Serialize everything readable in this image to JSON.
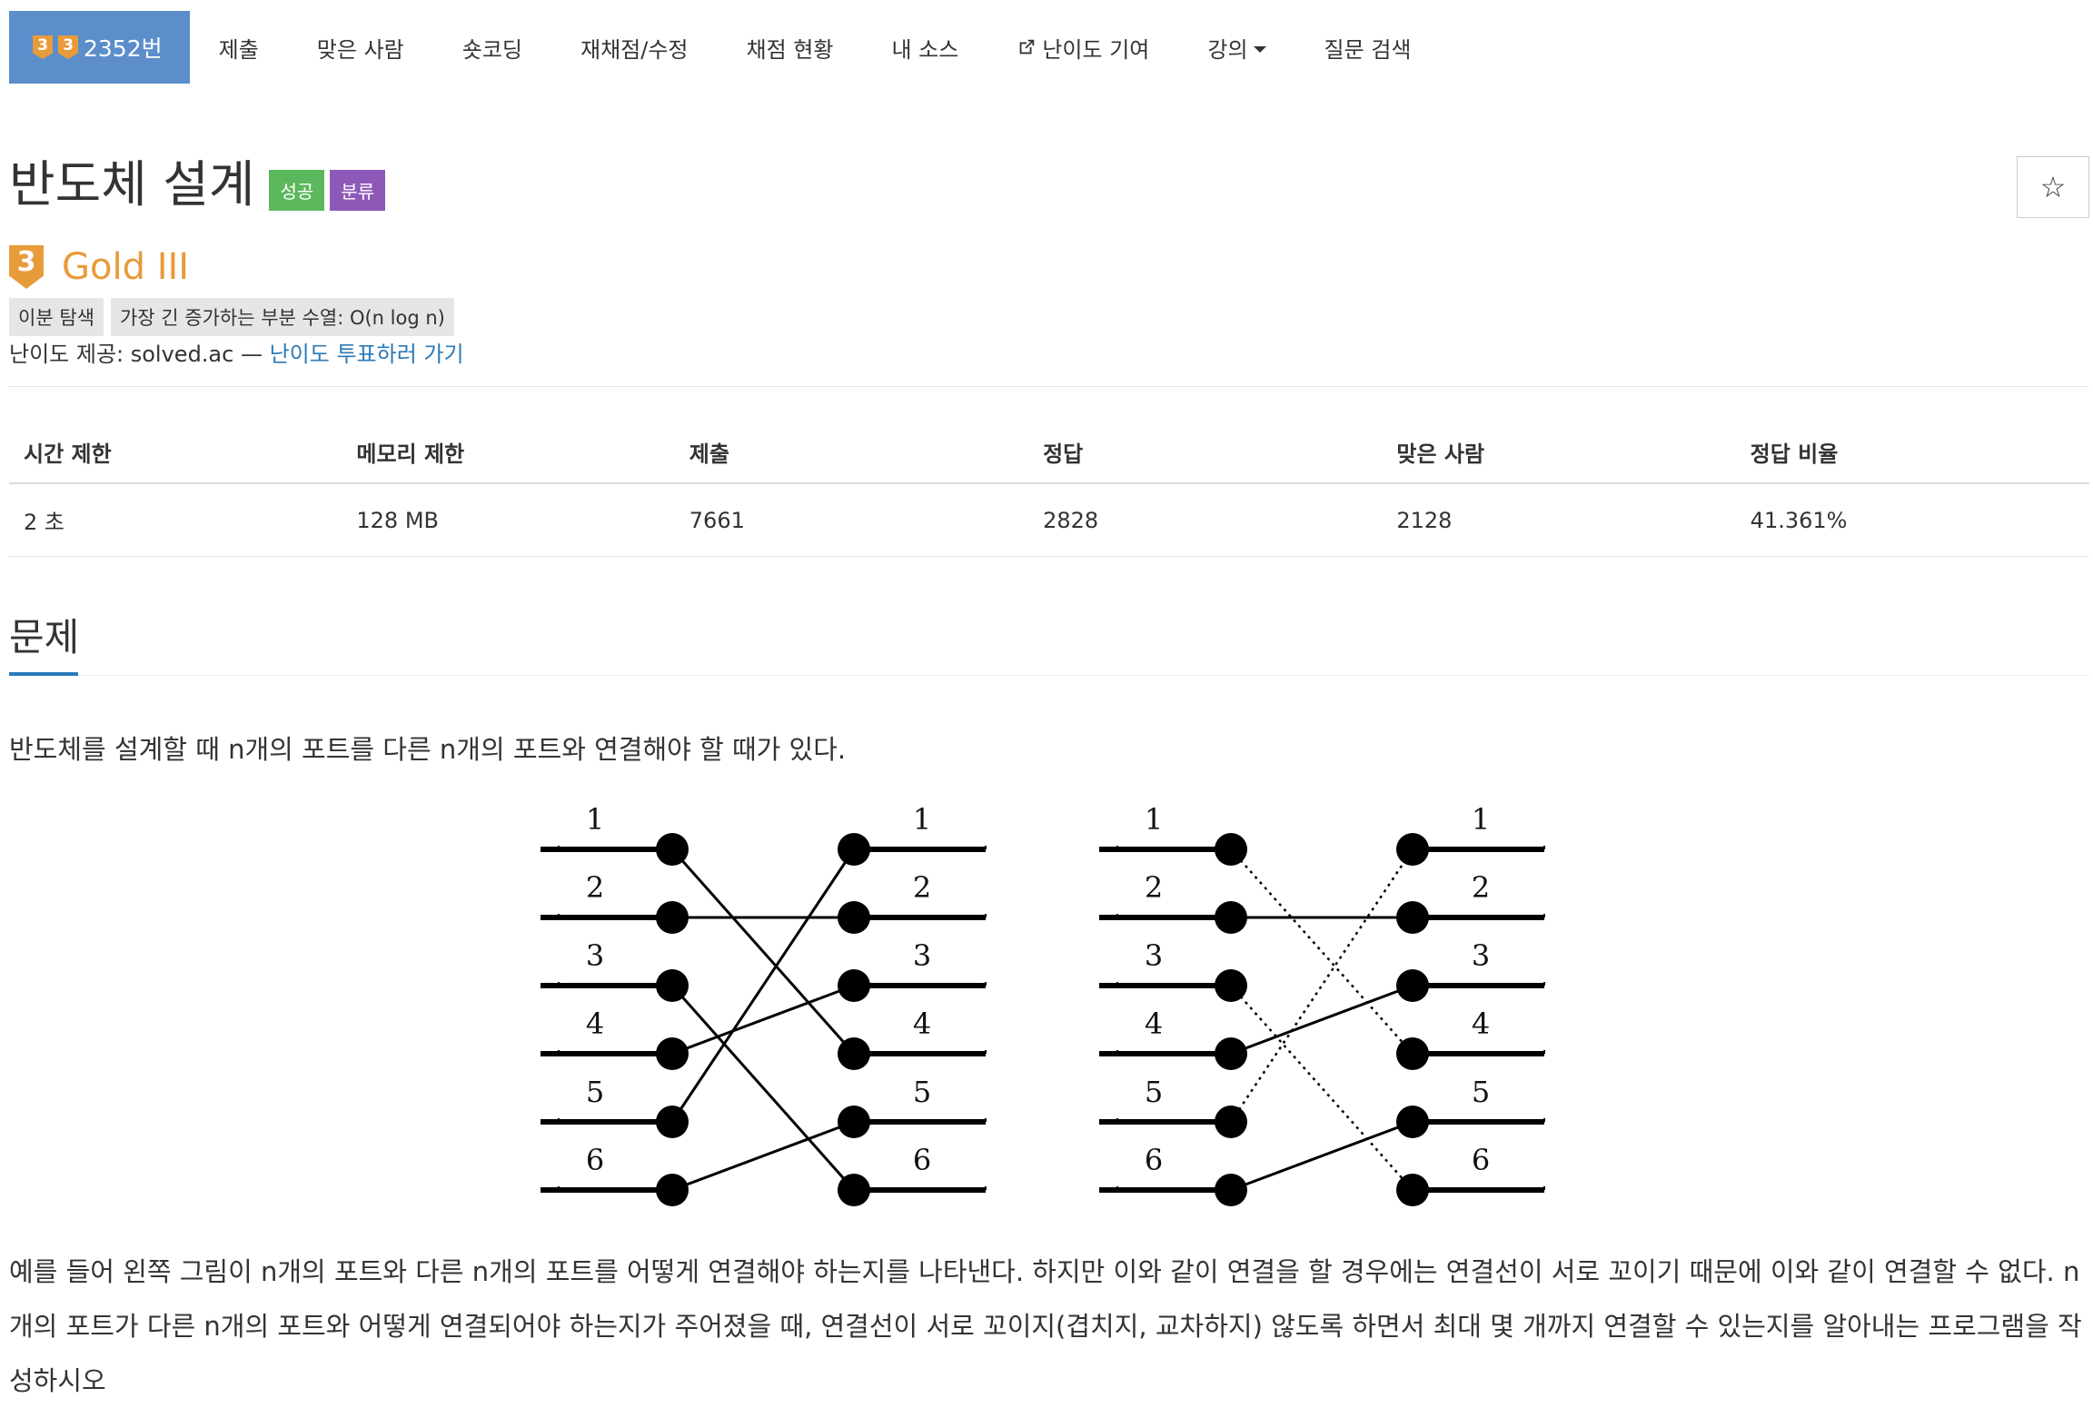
{
  "nav": {
    "problem_tiers": [
      "3",
      "3"
    ],
    "problem_number": "2352번",
    "items": [
      "제출",
      "맞은 사람",
      "숏코딩",
      "재채점/수정",
      "채점 현황",
      "내 소스"
    ],
    "contribute": "난이도 기여",
    "lecture": "강의",
    "qna": "질문 검색"
  },
  "problem": {
    "title": "반도체 설계",
    "badge_success": "성공",
    "badge_category": "분류",
    "star": "☆",
    "tier_number": "3",
    "tier_name": "Gold III",
    "tags": [
      "이분 탐색",
      "가장 긴 증가하는 부분 수열: O(n log n)"
    ],
    "provider_prefix": "난이도 제공: solved.ac — ",
    "vote_link": "난이도 투표하러 가기"
  },
  "table": {
    "headers": [
      "시간 제한",
      "메모리 제한",
      "제출",
      "정답",
      "맞은 사람",
      "정답 비율"
    ],
    "values": [
      "2 초",
      "128 MB",
      "7661",
      "2828",
      "2128",
      "41.361%"
    ]
  },
  "section": {
    "title": "문제",
    "intro": "반도체를 설계할 때 n개의 포트를 다른 n개의 포트와 연결해야 할 때가 있다.",
    "description": "예를 들어 왼쪽 그림이 n개의 포트와 다른 n개의 포트를 어떻게 연결해야 하는지를 나타낸다. 하지만 이와 같이 연결을 할 경우에는 연결선이 서로 꼬이기 때문에 이와 같이 연결할 수 없다. n개의 포트가 다른 n개의 포트와 어떻게 연결되어야 하는지가 주어졌을 때, 연결선이 서로 꼬이지(겹치지, 교차하지) 않도록 하면서 최대 몇 개까지 연결할 수 있는지를 알아내는 프로그램을 작성하시오"
  },
  "figure": {
    "port_labels": [
      "1",
      "2",
      "3",
      "4",
      "5",
      "6"
    ],
    "connections": [
      4,
      2,
      6,
      3,
      1,
      5
    ],
    "kept_connections": [
      2,
      3,
      5
    ]
  },
  "colors": {
    "active_tab": "#5b8ecb",
    "gold": "#e89b3a",
    "success": "#5cb85c",
    "category": "#8c59b8",
    "link": "#2a7ab8"
  }
}
